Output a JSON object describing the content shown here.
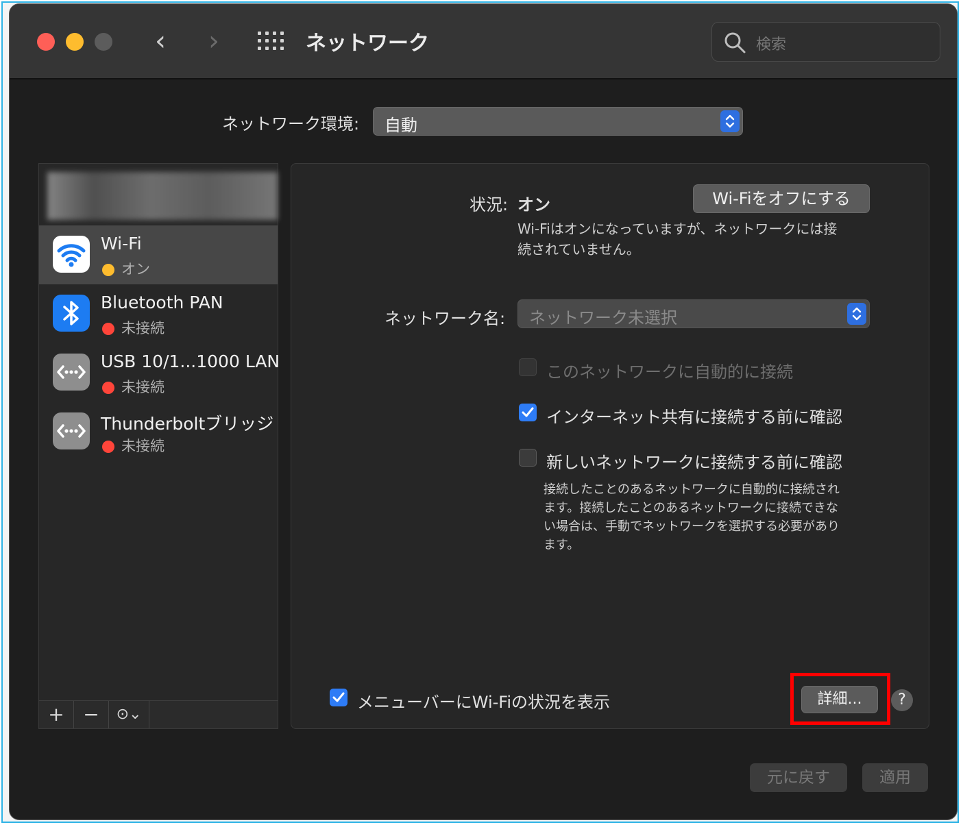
{
  "window": {
    "title": "ネットワーク",
    "search_placeholder": "検索"
  },
  "location": {
    "label": "ネットワーク環境:",
    "value": "自動"
  },
  "services": [
    {
      "name": "Wi-Fi",
      "status": "オン",
      "status_color": "#febc2e",
      "icon": "wifi-icon",
      "selected": true
    },
    {
      "name": "Bluetooth PAN",
      "status": "未接続",
      "status_color": "#ff453a",
      "icon": "bluetooth-icon",
      "selected": false
    },
    {
      "name": "USB 10/1...1000 LAN",
      "status": "未接続",
      "status_color": "#ff453a",
      "icon": "ethernet-icon",
      "selected": false
    },
    {
      "name": "Thunderboltブリッジ",
      "status": "未接続",
      "status_color": "#ff453a",
      "icon": "ethernet-icon",
      "selected": false
    }
  ],
  "sidebar_toolbar": {
    "add": "+",
    "remove": "−",
    "action": "⊙⌄"
  },
  "detail": {
    "status_label": "状況:",
    "status_value": "オン",
    "toggle_button": "Wi-Fiをオフにする",
    "status_desc_line1": "Wi-Fiはオンになっていますが、ネットワークには接",
    "status_desc_line2": "続されていません。",
    "network_name_label": "ネットワーク名:",
    "network_name_value": "ネットワーク未選択",
    "auto_join_label": "このネットワークに自動的に接続",
    "ask_hotspot_label": "インターネット共有に接続する前に確認",
    "ask_new_label": "新しいネットワークに接続する前に確認",
    "ask_new_note_line1": "接続したことのあるネットワークに自動的に接続され",
    "ask_new_note_line2": "ます。接続したことのあるネットワークに接続できな",
    "ask_new_note_line3": "い場合は、手動でネットワークを選択する必要があり",
    "ask_new_note_line4": "ます。",
    "show_menubar_label": "メニューバーにWi-Fiの状況を表示",
    "advanced_button": "詳細...",
    "help": "?"
  },
  "footer": {
    "revert": "元に戻す",
    "apply": "適用"
  },
  "colors": {
    "accent": "#2e7cf6",
    "highlight": "#ff0000",
    "frame": "#2fb3e6"
  }
}
